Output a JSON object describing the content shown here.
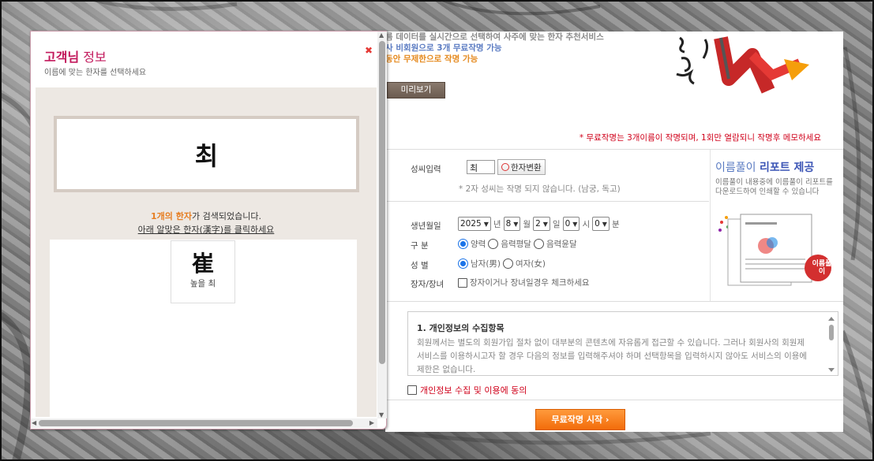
{
  "popup": {
    "title_accent": "고객님",
    "title_rest": " 정보",
    "subtitle": "이름에 맞는 한자를 선택하세요",
    "name_display": "최",
    "found_count": "1개의 한자",
    "found_suffix": "가 검색되었습니다.",
    "instruction": "아래 알맞은 한자(漢字)를 클릭하세요",
    "results": [
      {
        "hanja": "崔",
        "meaning": "높을 최"
      }
    ]
  },
  "page": {
    "promo": {
      "line1": "름 데이터를 실시간으로 선택하여 사주에 맞는 한자 추천서비스",
      "line2": "사 비회원으로 3개 무료작명 가능",
      "line3": "동안 무제한으로 작명 가능"
    },
    "preview_label": "미리보기",
    "notice": "* 무료작명는 3개이름이 작명되며, 1회만 열람되니 작명후 메모하세요",
    "form": {
      "surname_label": "성씨입력",
      "surname_value": "최",
      "convert_label": "한자변환",
      "surname_note": "* 2자 성씨는 작명 되지 않습니다. (남궁, 독고)",
      "birth_label": "생년월일",
      "year": "2025",
      "year_unit": "년",
      "month": "8",
      "month_unit": "월",
      "day": "2",
      "day_unit": "일",
      "hour": "0",
      "hour_unit": "시",
      "minute": "0",
      "minute_unit": "분",
      "calendar_label": "구 분",
      "calendar_options": [
        "양력",
        "음력평달",
        "음력윤달"
      ],
      "gender_label": "성 별",
      "gender_options": [
        "남자(男)",
        "여자(女)"
      ],
      "eldest_label": "장자/장녀",
      "eldest_text": "장자이거나 장녀일경우 체크하세요"
    },
    "report": {
      "title_plain": "이름풀이 ",
      "title_bold": "리포트 제공",
      "desc": "이름풀이 내용중에 이름풀이 리포트를 다운로드하여 인쇄할 수 있습니다",
      "badge": "이름풀이"
    },
    "terms": {
      "heading": "1. 개인정보의 수집항목",
      "body": "회원께서는 별도의 회원가입 절차 없이 대부분의 콘텐츠에 자유롭게 접근할 수 있습니다. 그러나 회원사의 회원제 서비스를 이용하시고자 할 경우 다음의 정보를 입력해주셔야 하며 선택항목을 입력하시지 않아도 서비스의 이용에 제한은 없습니다."
    },
    "agree_label": "개인정보 수집 및 이용에 동의",
    "start_label": "무료작명 시작  ›"
  },
  "colors": {
    "accent_pink": "#c2185b",
    "found_orange": "#e67e22",
    "notice_red": "#d0021b",
    "start_orange": "#f26c0a",
    "report_blue": "#3b54b5",
    "beige": "#ede8e3"
  }
}
